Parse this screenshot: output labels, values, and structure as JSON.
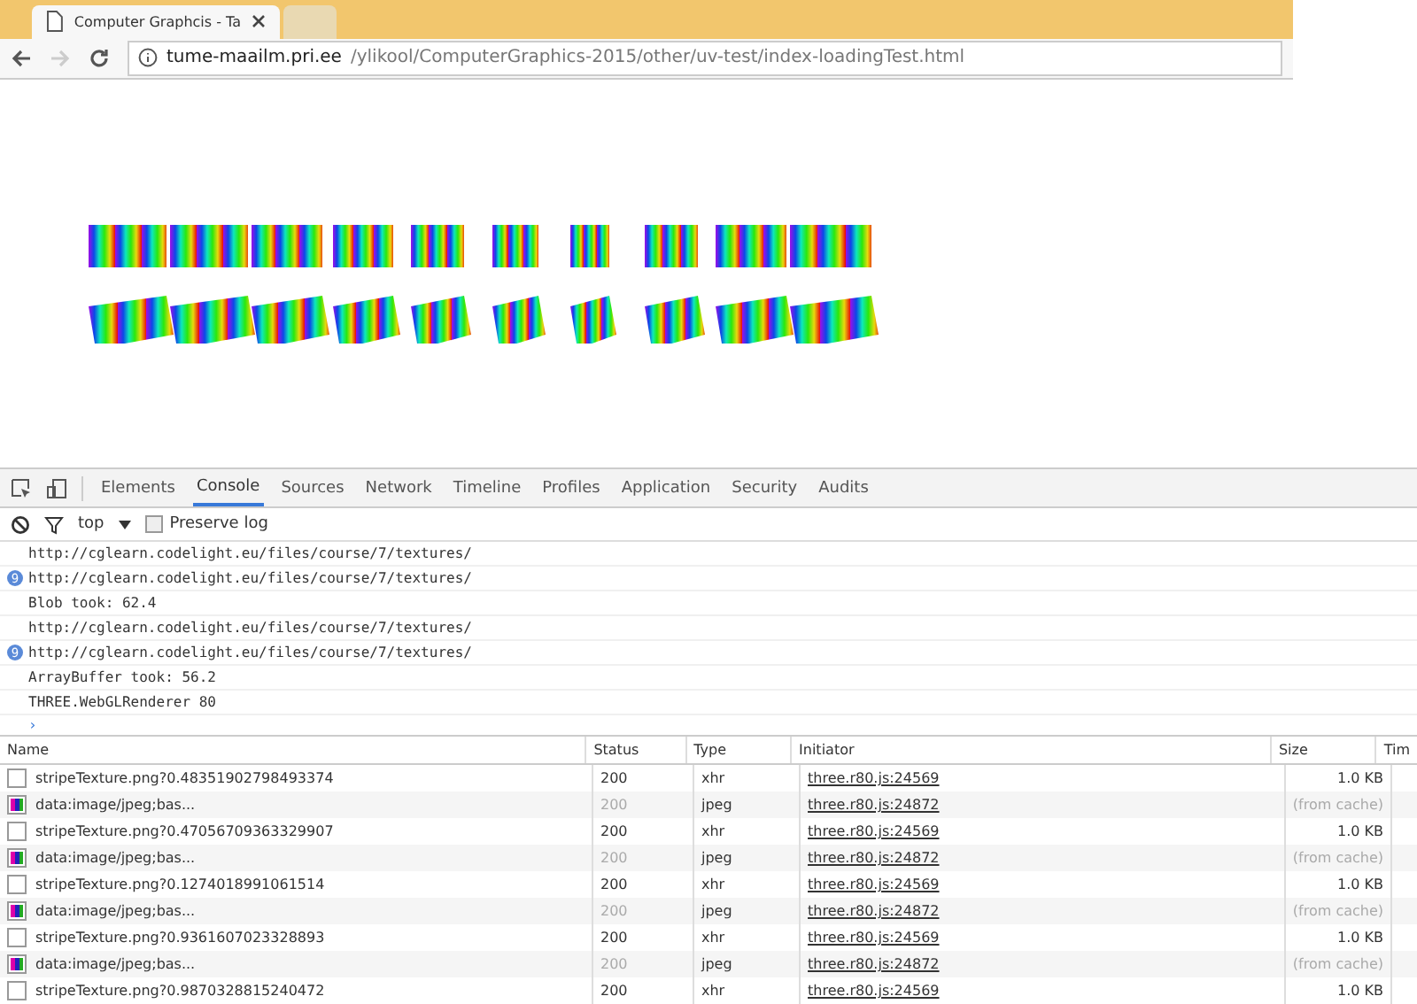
{
  "browser": {
    "tabs": [
      {
        "title": "Computer Graphcis - Ta",
        "selected": true
      },
      {
        "selected": false
      }
    ],
    "url_host": "tume-maailm.pri.ee",
    "url_path": "/ylikool/ComputerGraphics-2015/other/uv-test/index-loadingTest.html"
  },
  "devtools": {
    "tabs": [
      {
        "label": "Elements",
        "selected": false
      },
      {
        "label": "Console",
        "selected": true
      },
      {
        "label": "Sources",
        "selected": false
      },
      {
        "label": "Network",
        "selected": false
      },
      {
        "label": "Timeline",
        "selected": false
      },
      {
        "label": "Profiles",
        "selected": false
      },
      {
        "label": "Application",
        "selected": false
      },
      {
        "label": "Security",
        "selected": false
      },
      {
        "label": "Audits",
        "selected": false
      }
    ],
    "context": "top",
    "preserve_log": {
      "label": "Preserve log",
      "checked": false
    },
    "console_lines": [
      {
        "text": "http://cglearn.codelight.eu/files/course/7/textures/"
      },
      {
        "text": "http://cglearn.codelight.eu/files/course/7/textures/",
        "count": "9"
      },
      {
        "text": "Blob took: 62.4"
      },
      {
        "text": "http://cglearn.codelight.eu/files/course/7/textures/"
      },
      {
        "text": "http://cglearn.codelight.eu/files/course/7/textures/",
        "count": "9"
      },
      {
        "text": "ArrayBuffer took: 56.2"
      },
      {
        "text": "THREE.WebGLRenderer 80"
      }
    ],
    "prompt": "›"
  },
  "network": {
    "columns": [
      "Name",
      "Status",
      "Type",
      "Initiator",
      "Size",
      "Tim"
    ],
    "rows": [
      {
        "kind": "file",
        "name": "stripeTexture.png?0.48351902798493374",
        "status": "200",
        "type": "xhr",
        "initiator": "three.r80.js:24569",
        "size": "1.0 KB",
        "from_cache": false
      },
      {
        "kind": "image",
        "name": "data:image/jpeg;bas...",
        "status": "200",
        "type": "jpeg",
        "initiator": "three.r80.js:24872",
        "size": "(from cache)",
        "from_cache": true
      },
      {
        "kind": "file",
        "name": "stripeTexture.png?0.47056709363329907",
        "status": "200",
        "type": "xhr",
        "initiator": "three.r80.js:24569",
        "size": "1.0 KB",
        "from_cache": false
      },
      {
        "kind": "image",
        "name": "data:image/jpeg;bas...",
        "status": "200",
        "type": "jpeg",
        "initiator": "three.r80.js:24872",
        "size": "(from cache)",
        "from_cache": true
      },
      {
        "kind": "file",
        "name": "stripeTexture.png?0.1274018991061514",
        "status": "200",
        "type": "xhr",
        "initiator": "three.r80.js:24569",
        "size": "1.0 KB",
        "from_cache": false
      },
      {
        "kind": "image",
        "name": "data:image/jpeg;bas...",
        "status": "200",
        "type": "jpeg",
        "initiator": "three.r80.js:24872",
        "size": "(from cache)",
        "from_cache": true
      },
      {
        "kind": "file",
        "name": "stripeTexture.png?0.9361607023328893",
        "status": "200",
        "type": "xhr",
        "initiator": "three.r80.js:24569",
        "size": "1.0 KB",
        "from_cache": false
      },
      {
        "kind": "image",
        "name": "data:image/jpeg;bas...",
        "status": "200",
        "type": "jpeg",
        "initiator": "three.r80.js:24872",
        "size": "(from cache)",
        "from_cache": true
      },
      {
        "kind": "file",
        "name": "stripeTexture.png?0.9870328815240472",
        "status": "200",
        "type": "xhr",
        "initiator": "three.r80.js:24569",
        "size": "1.0 KB",
        "from_cache": false
      }
    ]
  }
}
